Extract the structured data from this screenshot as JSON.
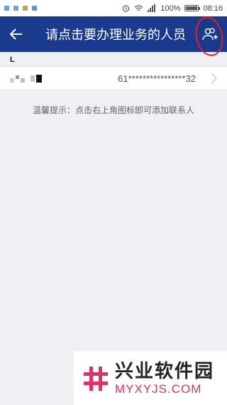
{
  "statusbar": {
    "battery": "100%",
    "time": "08:16",
    "signal_icon": "signal-icon",
    "wifi_icon": "wifi-icon",
    "alarm_icon": "alarm-icon"
  },
  "header": {
    "title": "请点击要办理业务的人员",
    "back_icon": "arrow-left-icon",
    "action_icon": "add-contact-icon",
    "background": "#1a3a8e"
  },
  "list": {
    "section": "L",
    "rows": [
      {
        "id": "61****************32"
      }
    ]
  },
  "tip": "温馨提示：点击右上角图标即可添加联系人",
  "watermark": {
    "name": "兴业软件园",
    "url": "MYXYJS.COM",
    "accent": "#e0306a"
  }
}
